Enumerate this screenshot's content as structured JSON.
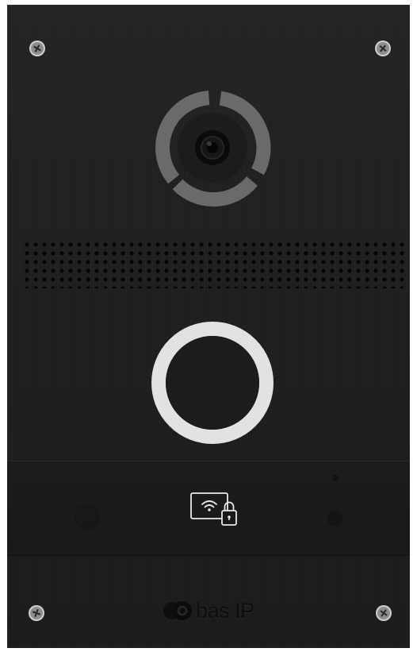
{
  "device": {
    "type": "video-intercom-door-panel",
    "brand_logo_text": "bas IP",
    "panel_color": "#1f1f1f",
    "call_button_ring_color": "#e2e2e2",
    "camera_ring_color": "#6a6a6a",
    "rfid_icon": "wifi-card-lock-icon"
  }
}
